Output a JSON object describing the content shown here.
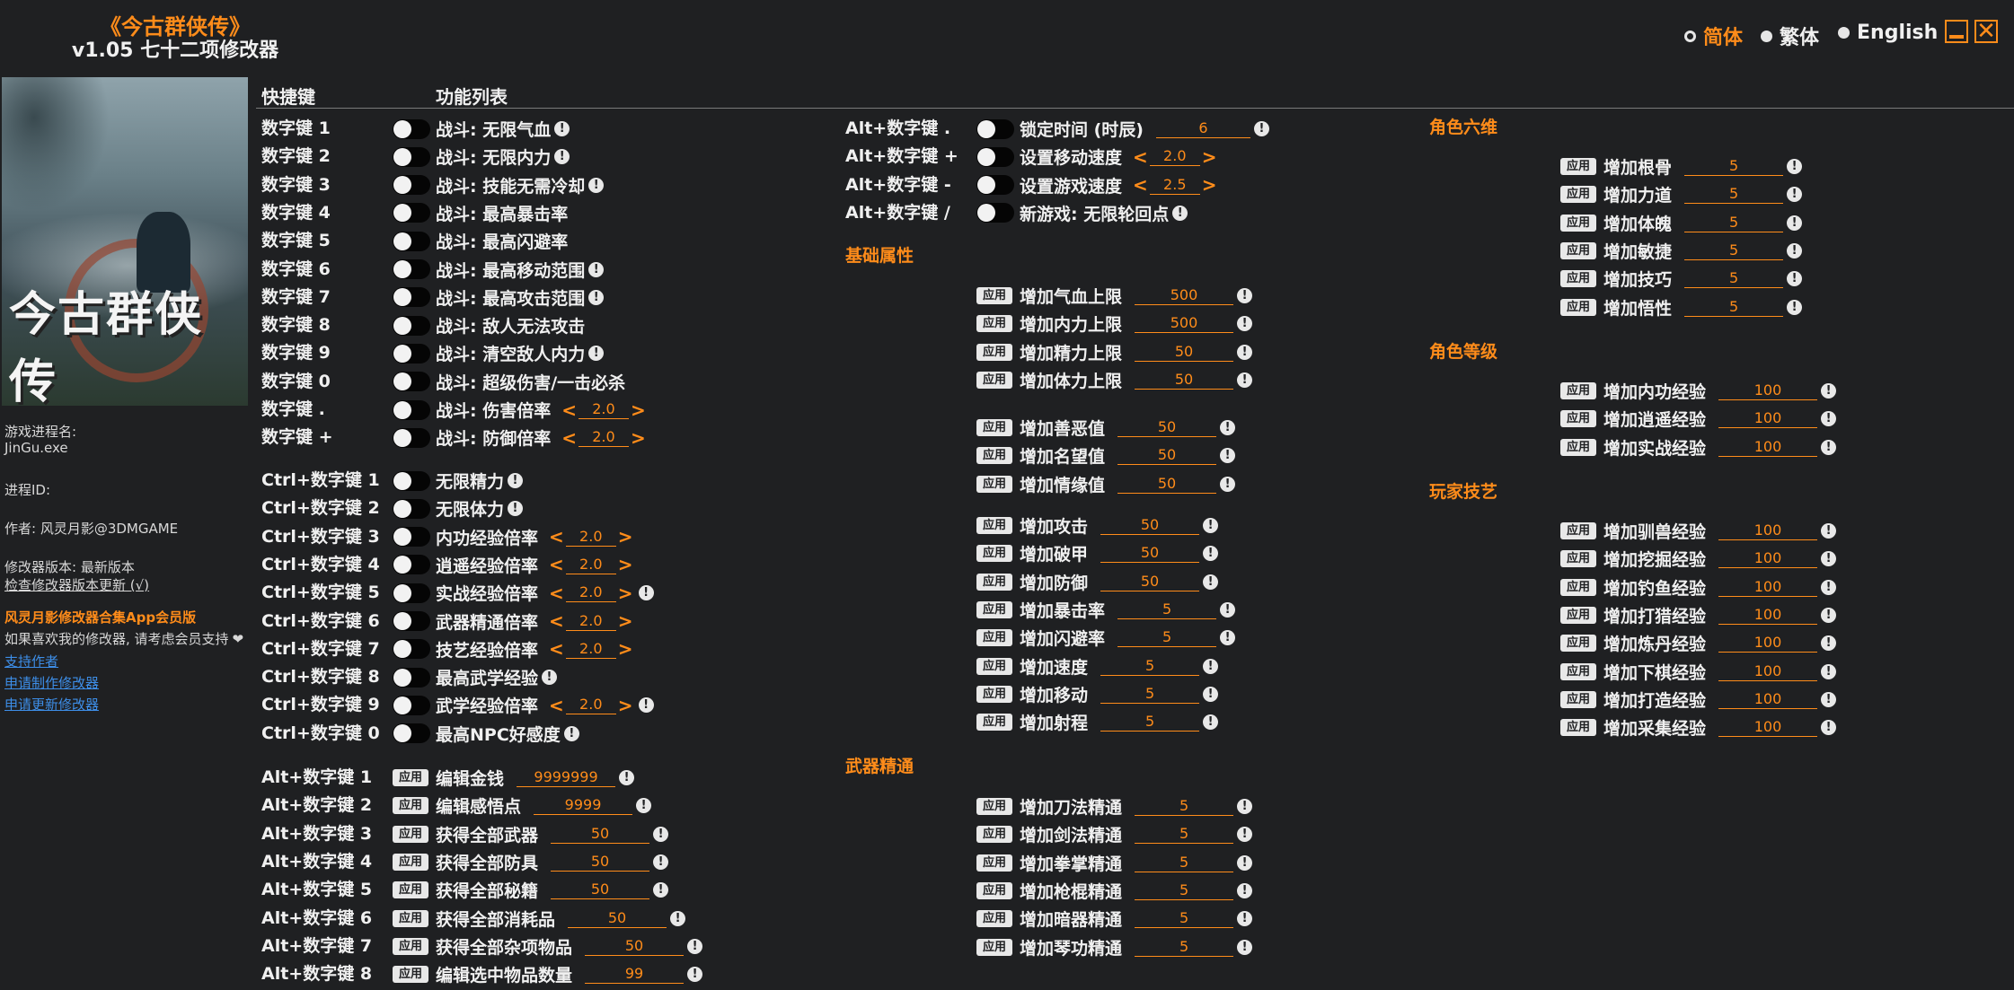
{
  "app": {
    "title": "《今古群侠传》",
    "subtitle": "v1.05 七十二项修改器"
  },
  "languages": [
    {
      "label": "简体",
      "selected": true
    },
    {
      "label": "繁体",
      "selected": false
    },
    {
      "label": "English",
      "selected": false
    }
  ],
  "window_buttons": {
    "minimize": "minimize-icon",
    "close": "close-icon"
  },
  "cover": {
    "logo_text": "今古群侠传"
  },
  "sidebar": {
    "process_name_label": "游戏进程名:",
    "process_name": "JinGu.exe",
    "process_id_label": "进程ID:",
    "author": "作者: 风灵月影@3DMGAME",
    "version": "修改器版本: 最新版本",
    "check_update": "检查修改器版本更新 (√)",
    "app_promo": "风灵月影修改器合集App会员版",
    "support_text": "如果喜欢我的修改器, 请考虑会员支持",
    "heart_icon": "heart-icon",
    "links": [
      "支持作者",
      "申请制作修改器",
      "申请更新修改器"
    ]
  },
  "headers": {
    "hotkey": "快捷键",
    "features": "功能列表"
  },
  "colors": {
    "accent": "#ff8c1a",
    "background": "#1f2022",
    "text": "#f0f0f0",
    "link": "#3d8ee8"
  },
  "col1_toggles": [
    {
      "key": "数字键 1",
      "label": "战斗: 无限气血",
      "info": true
    },
    {
      "key": "数字键 2",
      "label": "战斗: 无限内力",
      "info": true
    },
    {
      "key": "数字键 3",
      "label": "战斗: 技能无需冷却",
      "info": true
    },
    {
      "key": "数字键 4",
      "label": "战斗: 最高暴击率",
      "info": false
    },
    {
      "key": "数字键 5",
      "label": "战斗: 最高闪避率",
      "info": false
    },
    {
      "key": "数字键 6",
      "label": "战斗: 最高移动范围",
      "info": true
    },
    {
      "key": "数字键 7",
      "label": "战斗: 最高攻击范围",
      "info": true
    },
    {
      "key": "数字键 8",
      "label": "战斗: 敌人无法攻击",
      "info": false
    },
    {
      "key": "数字键 9",
      "label": "战斗: 清空敌人内力",
      "info": true
    },
    {
      "key": "数字键 0",
      "label": "战斗: 超级伤害/一击必杀",
      "info": false
    },
    {
      "key": "数字键 .",
      "label": "战斗: 伤害倍率",
      "stepper": "2.0",
      "info": false
    },
    {
      "key": "数字键 +",
      "label": "战斗: 防御倍率",
      "stepper": "2.0",
      "info": false
    }
  ],
  "col1_ctrl": [
    {
      "key": "Ctrl+数字键 1",
      "label": "无限精力",
      "info": true
    },
    {
      "key": "Ctrl+数字键 2",
      "label": "无限体力",
      "info": true
    },
    {
      "key": "Ctrl+数字键 3",
      "label": "内功经验倍率",
      "stepper": "2.0",
      "info": false
    },
    {
      "key": "Ctrl+数字键 4",
      "label": "逍遥经验倍率",
      "stepper": "2.0",
      "info": false
    },
    {
      "key": "Ctrl+数字键 5",
      "label": "实战经验倍率",
      "stepper": "2.0",
      "info": true
    },
    {
      "key": "Ctrl+数字键 6",
      "label": "武器精通倍率",
      "stepper": "2.0",
      "info": false
    },
    {
      "key": "Ctrl+数字键 7",
      "label": "技艺经验倍率",
      "stepper": "2.0",
      "info": false
    },
    {
      "key": "Ctrl+数字键 8",
      "label": "最高武学经验",
      "info": true
    },
    {
      "key": "Ctrl+数字键 9",
      "label": "武学经验倍率",
      "stepper": "2.0",
      "info": true
    },
    {
      "key": "Ctrl+数字键 0",
      "label": "最高NPC好感度",
      "info": true
    }
  ],
  "col1_alt": [
    {
      "key": "Alt+数字键 1",
      "label": "编辑金钱",
      "value": "9999999"
    },
    {
      "key": "Alt+数字键 2",
      "label": "编辑感悟点",
      "value": "9999"
    },
    {
      "key": "Alt+数字键 3",
      "label": "获得全部武器",
      "value": "50"
    },
    {
      "key": "Alt+数字键 4",
      "label": "获得全部防具",
      "value": "50"
    },
    {
      "key": "Alt+数字键 5",
      "label": "获得全部秘籍",
      "value": "50"
    },
    {
      "key": "Alt+数字键 6",
      "label": "获得全部消耗品",
      "value": "50"
    },
    {
      "key": "Alt+数字键 7",
      "label": "获得全部杂项物品",
      "value": "50"
    },
    {
      "key": "Alt+数字键 8",
      "label": "编辑选中物品数量",
      "value": "99"
    }
  ],
  "apply_label": "应用",
  "col2_alt": [
    {
      "key": "Alt+数字键 .",
      "label": "锁定时间 (时辰)",
      "value": "6",
      "info": true
    },
    {
      "key": "Alt+数字键 +",
      "label": "设置移动速度",
      "stepper": "2.0",
      "info": false
    },
    {
      "key": "Alt+数字键 -",
      "label": "设置游戏速度",
      "stepper": "2.5",
      "info": false
    },
    {
      "key": "Alt+数字键 /",
      "label": "新游戏: 无限轮回点",
      "info": true
    }
  ],
  "sections": {
    "basic": "基础属性",
    "weapon": "武器精通",
    "six": "角色六维",
    "level": "角色等级",
    "skill": "玩家技艺"
  },
  "basic_groups": [
    [
      {
        "label": "增加气血上限",
        "value": "500"
      },
      {
        "label": "增加内力上限",
        "value": "500"
      },
      {
        "label": "增加精力上限",
        "value": "50"
      },
      {
        "label": "增加体力上限",
        "value": "50"
      }
    ],
    [
      {
        "label": "增加善恶值",
        "value": "50"
      },
      {
        "label": "增加名望值",
        "value": "50"
      },
      {
        "label": "增加情缘值",
        "value": "50"
      }
    ],
    [
      {
        "label": "增加攻击",
        "value": "50"
      },
      {
        "label": "增加破甲",
        "value": "50"
      },
      {
        "label": "增加防御",
        "value": "50"
      },
      {
        "label": "增加暴击率",
        "value": "5"
      },
      {
        "label": "增加闪避率",
        "value": "5"
      },
      {
        "label": "增加速度",
        "value": "5"
      },
      {
        "label": "增加移动",
        "value": "5"
      },
      {
        "label": "增加射程",
        "value": "5"
      }
    ]
  ],
  "weapon_items": [
    {
      "label": "增加刀法精通",
      "value": "5"
    },
    {
      "label": "增加剑法精通",
      "value": "5"
    },
    {
      "label": "增加拳掌精通",
      "value": "5"
    },
    {
      "label": "增加枪棍精通",
      "value": "5"
    },
    {
      "label": "增加暗器精通",
      "value": "5"
    },
    {
      "label": "增加琴功精通",
      "value": "5"
    }
  ],
  "six_items": [
    {
      "label": "增加根骨",
      "value": "5"
    },
    {
      "label": "增加力道",
      "value": "5"
    },
    {
      "label": "增加体魄",
      "value": "5"
    },
    {
      "label": "增加敏捷",
      "value": "5"
    },
    {
      "label": "增加技巧",
      "value": "5"
    },
    {
      "label": "增加悟性",
      "value": "5"
    }
  ],
  "level_items": [
    {
      "label": "增加内功经验",
      "value": "100"
    },
    {
      "label": "增加逍遥经验",
      "value": "100"
    },
    {
      "label": "增加实战经验",
      "value": "100"
    }
  ],
  "skill_items": [
    {
      "label": "增加驯兽经验",
      "value": "100"
    },
    {
      "label": "增加挖掘经验",
      "value": "100"
    },
    {
      "label": "增加钓鱼经验",
      "value": "100"
    },
    {
      "label": "增加打猎经验",
      "value": "100"
    },
    {
      "label": "增加炼丹经验",
      "value": "100"
    },
    {
      "label": "增加下棋经验",
      "value": "100"
    },
    {
      "label": "增加打造经验",
      "value": "100"
    },
    {
      "label": "增加采集经验",
      "value": "100"
    }
  ]
}
